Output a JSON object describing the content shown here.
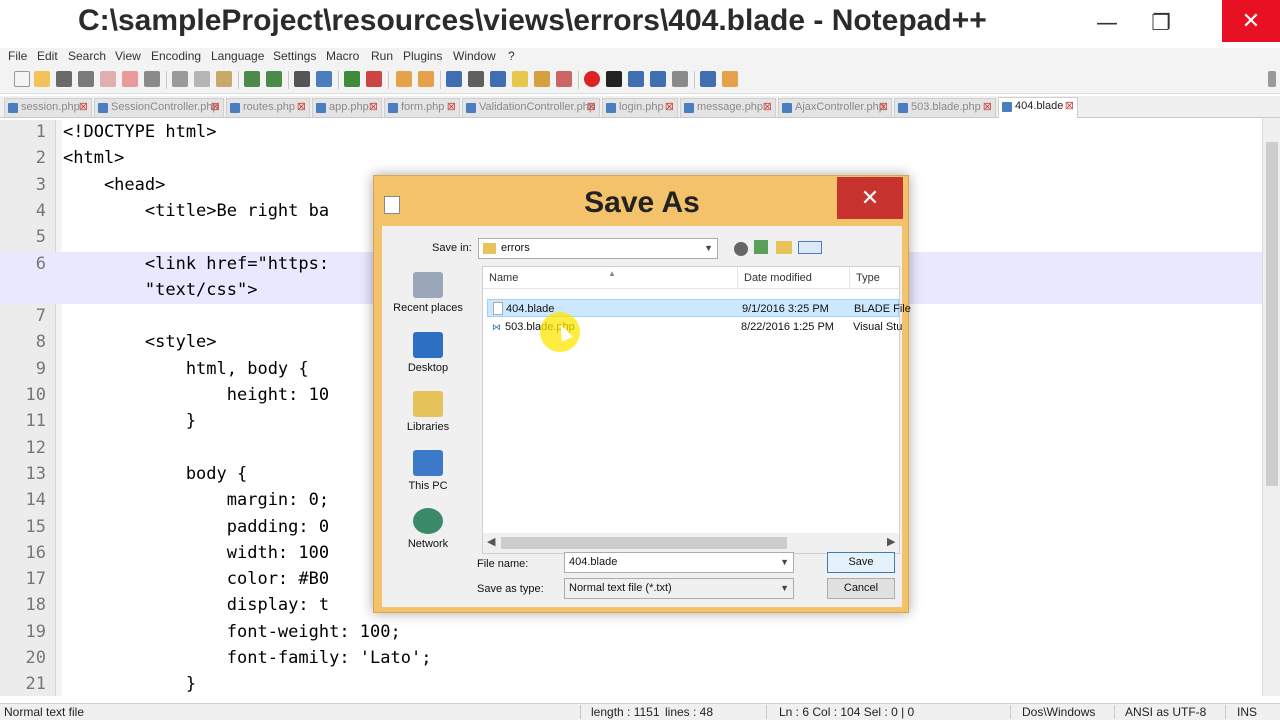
{
  "window": {
    "title": "C:\\sampleProject\\resources\\views\\errors\\404.blade - Notepad++",
    "min_glyph": "—",
    "max_glyph": "❐",
    "close_glyph": "✕"
  },
  "menu": [
    "File",
    "Edit",
    "Search",
    "View",
    "Encoding",
    "Language",
    "Settings",
    "Macro",
    "Run",
    "Plugins",
    "Window",
    "?"
  ],
  "tabs": [
    {
      "label": "session.php"
    },
    {
      "label": "SessionController.php"
    },
    {
      "label": "routes.php"
    },
    {
      "label": "app.php"
    },
    {
      "label": "form.php"
    },
    {
      "label": "ValidationController.php"
    },
    {
      "label": "login.php"
    },
    {
      "label": "message.php"
    },
    {
      "label": "AjaxController.php"
    },
    {
      "label": "503.blade.php"
    },
    {
      "label": "404.blade"
    }
  ],
  "editor": {
    "lines": [
      {
        "n": "1",
        "code": "<!DOCTYPE html>"
      },
      {
        "n": "2",
        "code": "<html>"
      },
      {
        "n": "3",
        "code": "    <head>"
      },
      {
        "n": "4",
        "code": "        <title>Be right ba"
      },
      {
        "n": "5",
        "code": ""
      },
      {
        "n": "6",
        "code": "        <link href=\"https:                                  rel=\"stylesheet\" type="
      },
      {
        "n": "",
        "code": "        \"text/css\">"
      },
      {
        "n": "7",
        "code": ""
      },
      {
        "n": "8",
        "code": "        <style>"
      },
      {
        "n": "9",
        "code": "            html, body {"
      },
      {
        "n": "10",
        "code": "                height: 10"
      },
      {
        "n": "11",
        "code": "            }"
      },
      {
        "n": "12",
        "code": ""
      },
      {
        "n": "13",
        "code": "            body {"
      },
      {
        "n": "14",
        "code": "                margin: 0;"
      },
      {
        "n": "15",
        "code": "                padding: 0"
      },
      {
        "n": "16",
        "code": "                width: 100"
      },
      {
        "n": "17",
        "code": "                color: #B0"
      },
      {
        "n": "18",
        "code": "                display: t"
      },
      {
        "n": "19",
        "code": "                font-weight: 100;"
      },
      {
        "n": "20",
        "code": "                font-family: 'Lato';"
      },
      {
        "n": "21",
        "code": "            }"
      }
    ]
  },
  "status": {
    "file_type": "Normal text file",
    "length": "length : 1151",
    "lines": "lines : 48",
    "position": "Ln : 6    Col : 104    Sel : 0 | 0",
    "eol": "Dos\\Windows",
    "encoding": "ANSI as UTF-8",
    "mode": "INS"
  },
  "dialog": {
    "title": "Save As",
    "close_glyph": "✕",
    "save_in_label": "Save in:",
    "save_in_value": "errors",
    "places": [
      "Recent places",
      "Desktop",
      "Libraries",
      "This PC",
      "Network"
    ],
    "columns": {
      "name": "Name",
      "date": "Date modified",
      "type": "Type"
    },
    "files": [
      {
        "name": "404.blade",
        "date": "9/1/2016 3:25 PM",
        "type": "BLADE File"
      },
      {
        "name": "503.blade.php",
        "date": "8/22/2016 1:25 PM",
        "type": "Visual Stu"
      }
    ],
    "file_name_label": "File name:",
    "file_name_value": "404.blade",
    "save_type_label": "Save as type:",
    "save_type_value": "Normal text file (*.txt)",
    "save_button": "Save",
    "cancel_button": "Cancel"
  }
}
